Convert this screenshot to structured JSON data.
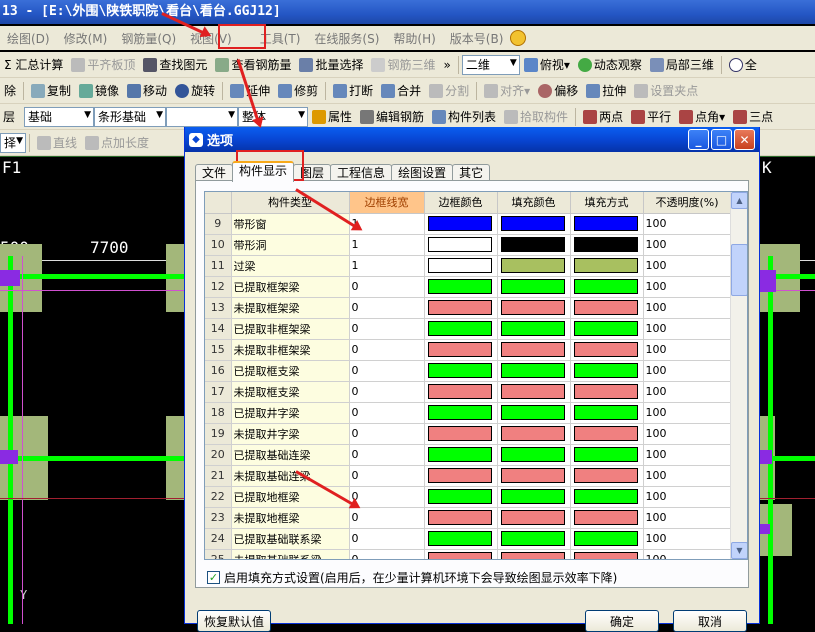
{
  "window": {
    "title": "13 - [E:\\外围\\陕铁职院\\看台\\看台.GGJ12]"
  },
  "menu": [
    {
      "label": "绘图(D)"
    },
    {
      "label": "修改(M)"
    },
    {
      "label": "钢筋量(Q)"
    },
    {
      "label": "视图(V)"
    },
    {
      "label": "工具(T)"
    },
    {
      "label": "在线服务(S)"
    },
    {
      "label": "帮助(H)"
    },
    {
      "label": "版本号(B)"
    }
  ],
  "toolbar1": {
    "items": [
      "Σ 汇总计算",
      "平齐板顶",
      "查找图元",
      "查看钢筋量",
      "批量选择",
      "钢筋三维"
    ],
    "more": "»",
    "view_combo": "二维",
    "view_items": [
      "俯视",
      "动态观察",
      "局部三维",
      "全"
    ]
  },
  "toolbar2": {
    "items": [
      "除",
      "复制",
      "镜像",
      "移动",
      "旋转",
      "延伸",
      "修剪",
      "打断",
      "合并",
      "分割",
      "对齐",
      "偏移",
      "拉伸",
      "设置夹点"
    ]
  },
  "toolbar3": {
    "combo1": "层",
    "combo2": "基础",
    "combo3": "条形基础",
    "combo4": "",
    "combo5": "整体",
    "items": [
      "属性",
      "编辑钢筋",
      "构件列表",
      "拾取构件",
      "两点",
      "平行",
      "点角",
      "三点"
    ]
  },
  "toolbar4": {
    "combo": "择",
    "items": [
      "直线",
      "点加长度"
    ]
  },
  "canvas": {
    "labels": [
      "F1",
      "K",
      "500",
      "7700",
      "Y"
    ]
  },
  "dialog": {
    "title": "选项",
    "tabs": [
      "文件",
      "构件显示",
      "图层",
      "工程信息",
      "绘图设置",
      "其它"
    ],
    "active_tab": 1,
    "columns": [
      "",
      "构件类型",
      "边框线宽",
      "边框颜色",
      "填充颜色",
      "填充方式",
      "不透明度(%)"
    ],
    "rows": [
      {
        "no": "9",
        "name": "带形窗",
        "width": "1",
        "border": "#0000ff",
        "fill": "#0000ff",
        "mode": "#0000ff",
        "opacity": "100"
      },
      {
        "no": "10",
        "name": "带形洞",
        "width": "1",
        "border": "#ffffff",
        "fill": "#000000",
        "mode": "#000000",
        "opacity": "100"
      },
      {
        "no": "11",
        "name": "过梁",
        "width": "1",
        "border": "#ffffff",
        "fill": "#a8c060",
        "mode": "#a8c060",
        "opacity": "100"
      },
      {
        "no": "12",
        "name": "已提取框架梁",
        "width": "0",
        "border": "#00ff00",
        "fill": "#00ff00",
        "mode": "#00ff00",
        "opacity": "100"
      },
      {
        "no": "13",
        "name": "未提取框架梁",
        "width": "0",
        "border": "#f08080",
        "fill": "#f08080",
        "mode": "#f08080",
        "opacity": "100"
      },
      {
        "no": "14",
        "name": "已提取非框架梁",
        "width": "0",
        "border": "#00ff00",
        "fill": "#00ff00",
        "mode": "#00ff00",
        "opacity": "100"
      },
      {
        "no": "15",
        "name": "未提取非框架梁",
        "width": "0",
        "border": "#f08080",
        "fill": "#f08080",
        "mode": "#f08080",
        "opacity": "100"
      },
      {
        "no": "16",
        "name": "已提取框支梁",
        "width": "0",
        "border": "#00ff00",
        "fill": "#00ff00",
        "mode": "#00ff00",
        "opacity": "100"
      },
      {
        "no": "17",
        "name": "未提取框支梁",
        "width": "0",
        "border": "#f08080",
        "fill": "#f08080",
        "mode": "#f08080",
        "opacity": "100"
      },
      {
        "no": "18",
        "name": "已提取井字梁",
        "width": "0",
        "border": "#00ff00",
        "fill": "#00ff00",
        "mode": "#00ff00",
        "opacity": "100"
      },
      {
        "no": "19",
        "name": "未提取井字梁",
        "width": "0",
        "border": "#f08080",
        "fill": "#f08080",
        "mode": "#f08080",
        "opacity": "100"
      },
      {
        "no": "20",
        "name": "已提取基础连梁",
        "width": "0",
        "border": "#00ff00",
        "fill": "#00ff00",
        "mode": "#00ff00",
        "opacity": "100"
      },
      {
        "no": "21",
        "name": "未提取基础连梁",
        "width": "0",
        "border": "#f08080",
        "fill": "#f08080",
        "mode": "#f08080",
        "opacity": "100"
      },
      {
        "no": "22",
        "name": "已提取地框梁",
        "width": "0",
        "border": "#00ff00",
        "fill": "#00ff00",
        "mode": "#00ff00",
        "opacity": "100"
      },
      {
        "no": "23",
        "name": "未提取地框梁",
        "width": "0",
        "border": "#f08080",
        "fill": "#f08080",
        "mode": "#f08080",
        "opacity": "100"
      },
      {
        "no": "24",
        "name": "已提取基础联系梁",
        "width": "0",
        "border": "#00ff00",
        "fill": "#00ff00",
        "mode": "#00ff00",
        "opacity": "100"
      },
      {
        "no": "25",
        "name": "未提取基础联系梁",
        "width": "0",
        "border": "#f08080",
        "fill": "#f08080",
        "mode": "#f08080",
        "opacity": "100"
      }
    ],
    "checkbox_label": "启用填充方式设置(启用后，在少量计算机环境下会导致绘图显示效率下降)",
    "checkbox_checked": true,
    "reset_button": "恢复默认值",
    "ok_button": "确定",
    "cancel_button": "取消"
  },
  "colors": {
    "highlight": "#e02020",
    "accent": "#0846d4"
  }
}
